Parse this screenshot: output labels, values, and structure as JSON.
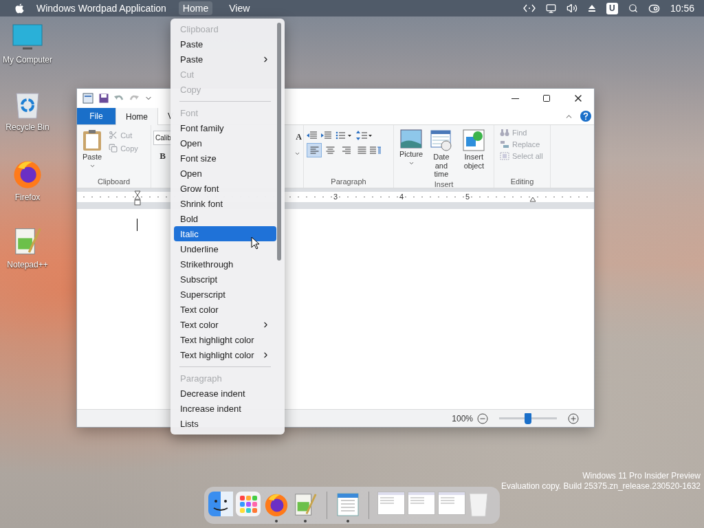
{
  "menubar": {
    "app_title": "Windows Wordpad Application",
    "menus": [
      {
        "label": "Home",
        "selected": true
      },
      {
        "label": "View",
        "selected": false
      }
    ],
    "status_badge": "U",
    "clock": "10:56"
  },
  "desktop_icons": [
    {
      "kind": "computer",
      "label": "My Computer"
    },
    {
      "kind": "recycle",
      "label": "Recycle Bin"
    },
    {
      "kind": "firefox",
      "label": "Firefox"
    },
    {
      "kind": "notepad",
      "label": "Notepad++"
    }
  ],
  "wordpad": {
    "tabs": [
      {
        "kind": "file",
        "label": "File",
        "selected": false
      },
      {
        "kind": "tab",
        "label": "Home",
        "selected": true
      },
      {
        "kind": "tab",
        "label": "V",
        "selected": false
      }
    ],
    "clipboard": {
      "group_label": "Clipboard",
      "paste": "Paste",
      "small_buttons": [
        {
          "kind": "cut",
          "label": "Cut",
          "disabled": true
        },
        {
          "kind": "copy",
          "label": "Copy",
          "disabled": true
        }
      ]
    },
    "font": {
      "font_name": "Calib",
      "bold_label": "B",
      "grow_label": "A"
    },
    "paragraph": {
      "group_label": "Paragraph",
      "alignments": [
        {
          "kind": "left",
          "selected": true
        },
        {
          "kind": "center",
          "selected": false
        },
        {
          "kind": "right",
          "selected": false
        },
        {
          "kind": "justify",
          "selected": false
        }
      ]
    },
    "insert": {
      "group_label": "Insert",
      "buttons": [
        {
          "kind": "picture",
          "label": "Picture",
          "dropdown": true
        },
        {
          "kind": "datetime",
          "label": "Date and time",
          "dropdown": false
        },
        {
          "kind": "object",
          "label": "Insert object",
          "dropdown": false
        }
      ]
    },
    "editing": {
      "group_label": "Editing",
      "buttons": [
        {
          "kind": "find",
          "label": "Find",
          "disabled": true
        },
        {
          "kind": "replace",
          "label": "Replace",
          "disabled": true
        },
        {
          "kind": "selectall",
          "label": "Select all",
          "disabled": true
        }
      ]
    },
    "ruler": {
      "labels": [
        "3",
        "4",
        "5"
      ]
    },
    "status": {
      "zoom": "100%",
      "zoom_slider": {
        "level": 0.5
      }
    }
  },
  "context_menu": {
    "items": [
      {
        "kind": "header",
        "label": "Clipboard"
      },
      {
        "kind": "item",
        "label": "Paste",
        "disabled": false,
        "selected": false,
        "submenu": false
      },
      {
        "kind": "item",
        "label": "Paste",
        "disabled": false,
        "selected": false,
        "submenu": true
      },
      {
        "kind": "item",
        "label": "Cut",
        "disabled": true,
        "selected": false,
        "submenu": false
      },
      {
        "kind": "item",
        "label": "Copy",
        "disabled": true,
        "selected": false,
        "submenu": false
      },
      {
        "kind": "separator"
      },
      {
        "kind": "header",
        "label": "Font"
      },
      {
        "kind": "item",
        "label": "Font family",
        "disabled": false,
        "selected": false,
        "submenu": false
      },
      {
        "kind": "item",
        "label": "Open",
        "disabled": false,
        "selected": false,
        "submenu": false
      },
      {
        "kind": "item",
        "label": "Font size",
        "disabled": false,
        "selected": false,
        "submenu": false
      },
      {
        "kind": "item",
        "label": "Open",
        "disabled": false,
        "selected": false,
        "submenu": false
      },
      {
        "kind": "item",
        "label": "Grow font",
        "disabled": false,
        "selected": false,
        "submenu": false
      },
      {
        "kind": "item",
        "label": "Shrink font",
        "disabled": false,
        "selected": false,
        "submenu": false
      },
      {
        "kind": "item",
        "label": "Bold",
        "disabled": false,
        "selected": false,
        "submenu": false
      },
      {
        "kind": "item",
        "label": "Italic",
        "disabled": false,
        "selected": true,
        "submenu": false
      },
      {
        "kind": "item",
        "label": "Underline",
        "disabled": false,
        "selected": false,
        "submenu": false
      },
      {
        "kind": "item",
        "label": "Strikethrough",
        "disabled": false,
        "selected": false,
        "submenu": false
      },
      {
        "kind": "item",
        "label": "Subscript",
        "disabled": false,
        "selected": false,
        "submenu": false
      },
      {
        "kind": "item",
        "label": "Superscript",
        "disabled": false,
        "selected": false,
        "submenu": false
      },
      {
        "kind": "item",
        "label": "Text color",
        "disabled": false,
        "selected": false,
        "submenu": false
      },
      {
        "kind": "item",
        "label": "Text color",
        "disabled": false,
        "selected": false,
        "submenu": true
      },
      {
        "kind": "item",
        "label": "Text highlight color",
        "disabled": false,
        "selected": false,
        "submenu": false
      },
      {
        "kind": "item",
        "label": "Text highlight color",
        "disabled": false,
        "selected": false,
        "submenu": true
      },
      {
        "kind": "separator"
      },
      {
        "kind": "header",
        "label": "Paragraph"
      },
      {
        "kind": "item",
        "label": "Decrease indent",
        "disabled": false,
        "selected": false,
        "submenu": false
      },
      {
        "kind": "item",
        "label": "Increase indent",
        "disabled": false,
        "selected": false,
        "submenu": false
      },
      {
        "kind": "item",
        "label": "Lists",
        "disabled": false,
        "selected": false,
        "submenu": false
      }
    ]
  },
  "dock": {
    "items": [
      {
        "kind": "finder",
        "running": false
      },
      {
        "kind": "launchpad",
        "running": false
      },
      {
        "kind": "firefox",
        "running": true
      },
      {
        "kind": "notepad",
        "running": true
      },
      {
        "kind": "divider"
      },
      {
        "kind": "wordpad",
        "running": true
      },
      {
        "kind": "divider"
      },
      {
        "kind": "window",
        "running": false
      },
      {
        "kind": "window",
        "running": false
      },
      {
        "kind": "window",
        "running": false
      },
      {
        "kind": "trash",
        "running": false
      }
    ]
  },
  "evaluation_notice": [
    "Windows 11 Pro Insider Preview",
    "Evaluation copy. Build 25375.zn_release.230520-1632"
  ]
}
